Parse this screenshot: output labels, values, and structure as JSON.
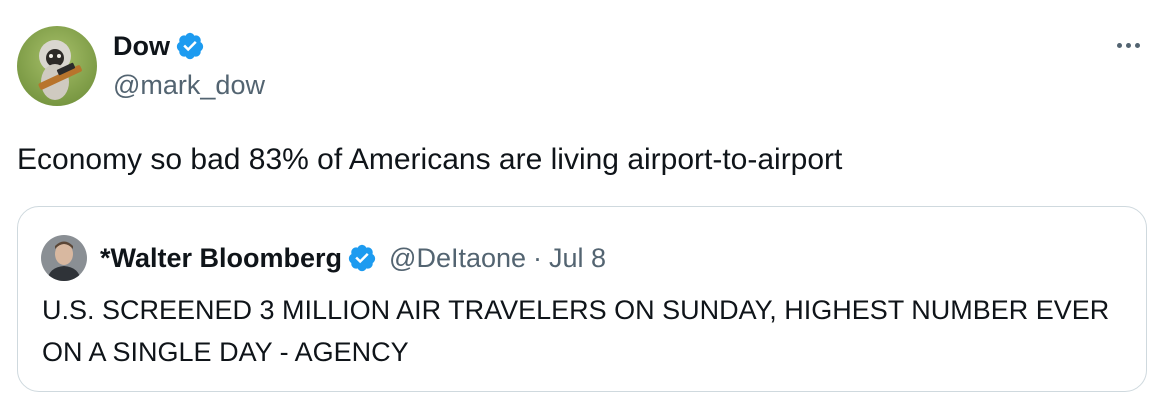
{
  "author": {
    "display_name": "Dow",
    "handle": "@mark_dow",
    "verified": true
  },
  "tweet": {
    "text": "Economy so bad 83% of Americans are living airport-to-airport"
  },
  "quoted_tweet": {
    "display_name": "*Walter Bloomberg",
    "handle": "@DeItaone",
    "separator": "·",
    "date": "Jul 8",
    "verified": true,
    "text": "U.S. SCREENED 3 MILLION AIR TRAVELERS ON SUNDAY, HIGHEST NUMBER EVER ON A SINGLE DAY - AGENCY"
  },
  "colors": {
    "verified_badge": "#1d9bf0",
    "secondary_text": "#536471",
    "primary_text": "#0f1419",
    "border": "#cfd9de"
  },
  "icons": {
    "more": "more-options-icon",
    "verified": "verified-badge-icon"
  }
}
